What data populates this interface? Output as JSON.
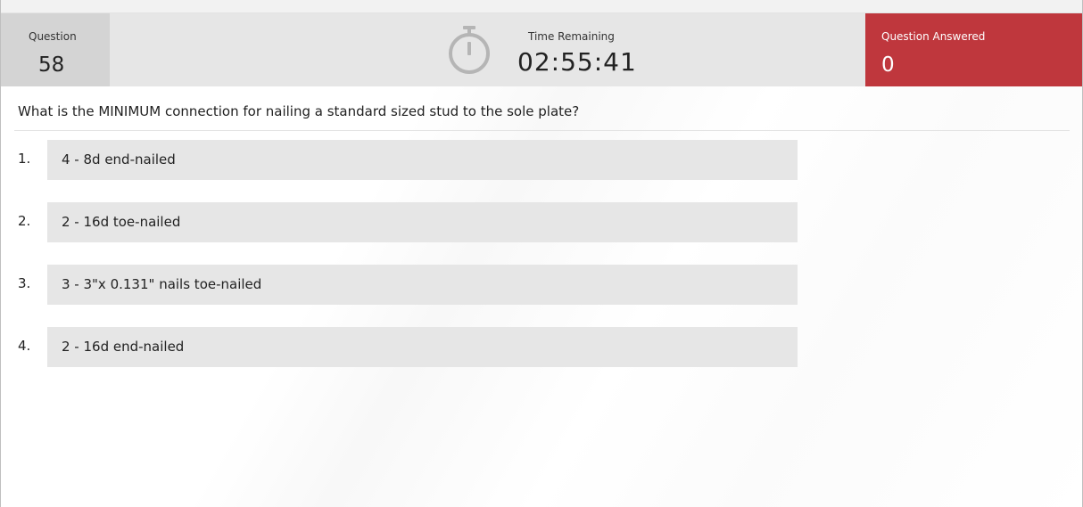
{
  "header": {
    "question_label": "Question",
    "question_number": "58",
    "time_label": "Time Remaining",
    "time_value": "02:55:41",
    "answered_label": "Question Answered",
    "answered_value": "0",
    "timer_icon": "stopwatch-icon"
  },
  "question": {
    "text": "What is the MINIMUM connection for nailing a standard sized stud to the sole plate?"
  },
  "answers": [
    {
      "number": "1.",
      "text": "4 - 8d end-nailed"
    },
    {
      "number": "2.",
      "text": "2 - 16d toe-nailed"
    },
    {
      "number": "3.",
      "text": "3 - 3\"x 0.131\" nails toe-nailed"
    },
    {
      "number": "4.",
      "text": "2 - 16d end-nailed"
    }
  ],
  "colors": {
    "header_bg": "#e6e6e6",
    "question_box_bg": "#d4d4d4",
    "answered_bg": "#bf373d",
    "answer_bg": "#e6e6e6"
  }
}
